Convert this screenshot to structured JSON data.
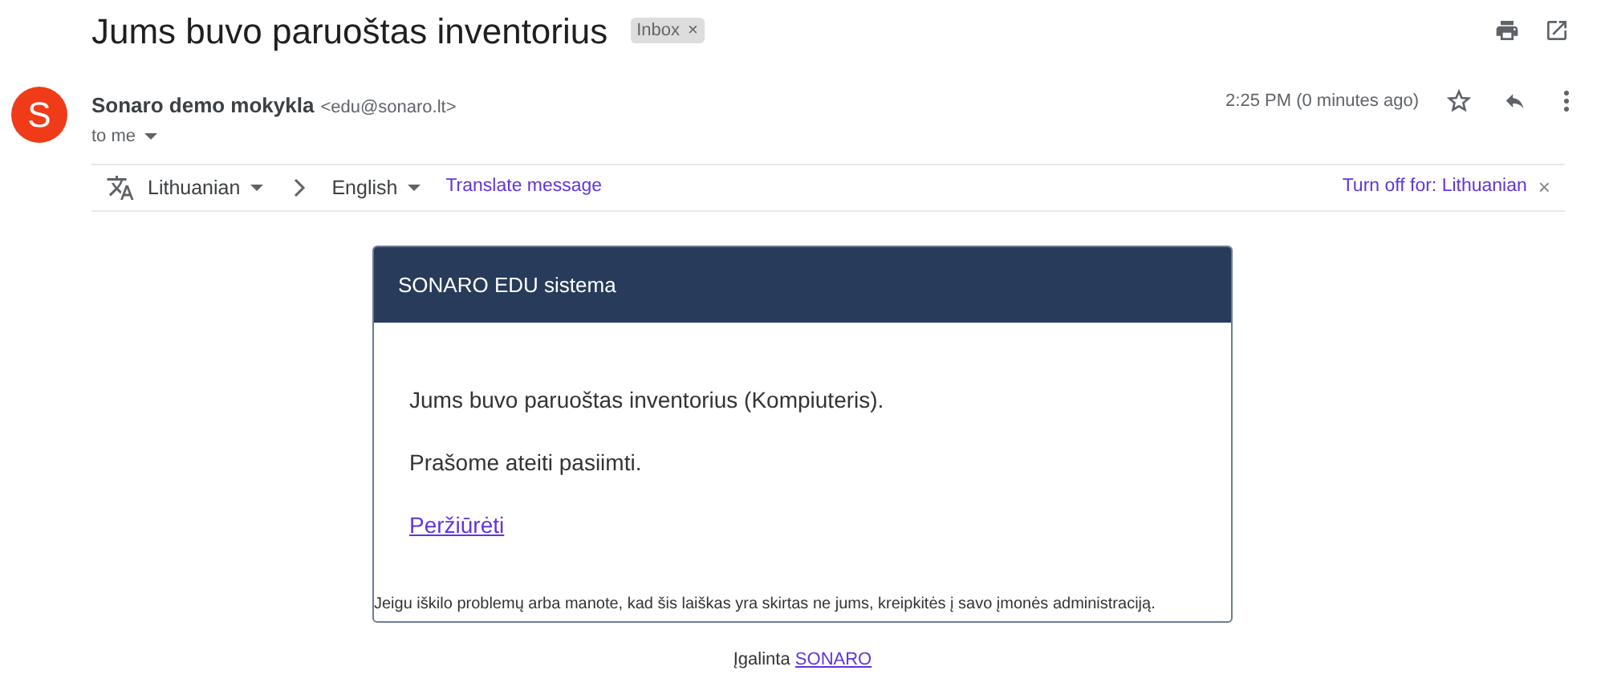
{
  "subject": "Jums buvo paruoštas inventorius",
  "label": {
    "text": "Inbox",
    "close": "×"
  },
  "sender": {
    "avatar": "S",
    "name": "Sonaro demo mokykla",
    "email": "<edu@sonaro.lt>",
    "to": "to me",
    "time": "2:25 PM (0 minutes ago)",
    "starred": false
  },
  "translate_bar": {
    "from": "Lithuanian",
    "to": "English",
    "action": "Translate message",
    "turn_off": "Turn off for: Lithuanian",
    "close": "×"
  },
  "email_card": {
    "header": "SONARO EDU sistema",
    "paragraphs": [
      "Jums buvo paruoštas inventorius (Kompiuteris).",
      "Prašome ateiti pasiimti."
    ],
    "link": "Peržiūrėti",
    "footer": "Jeigu iškilo problemų arba manote, kad šis laiškas yra skirtas ne jums, kreipkitės į savo įmonės administraciją."
  },
  "powered_by": {
    "text": "Įgalinta",
    "link": "SONARO"
  }
}
